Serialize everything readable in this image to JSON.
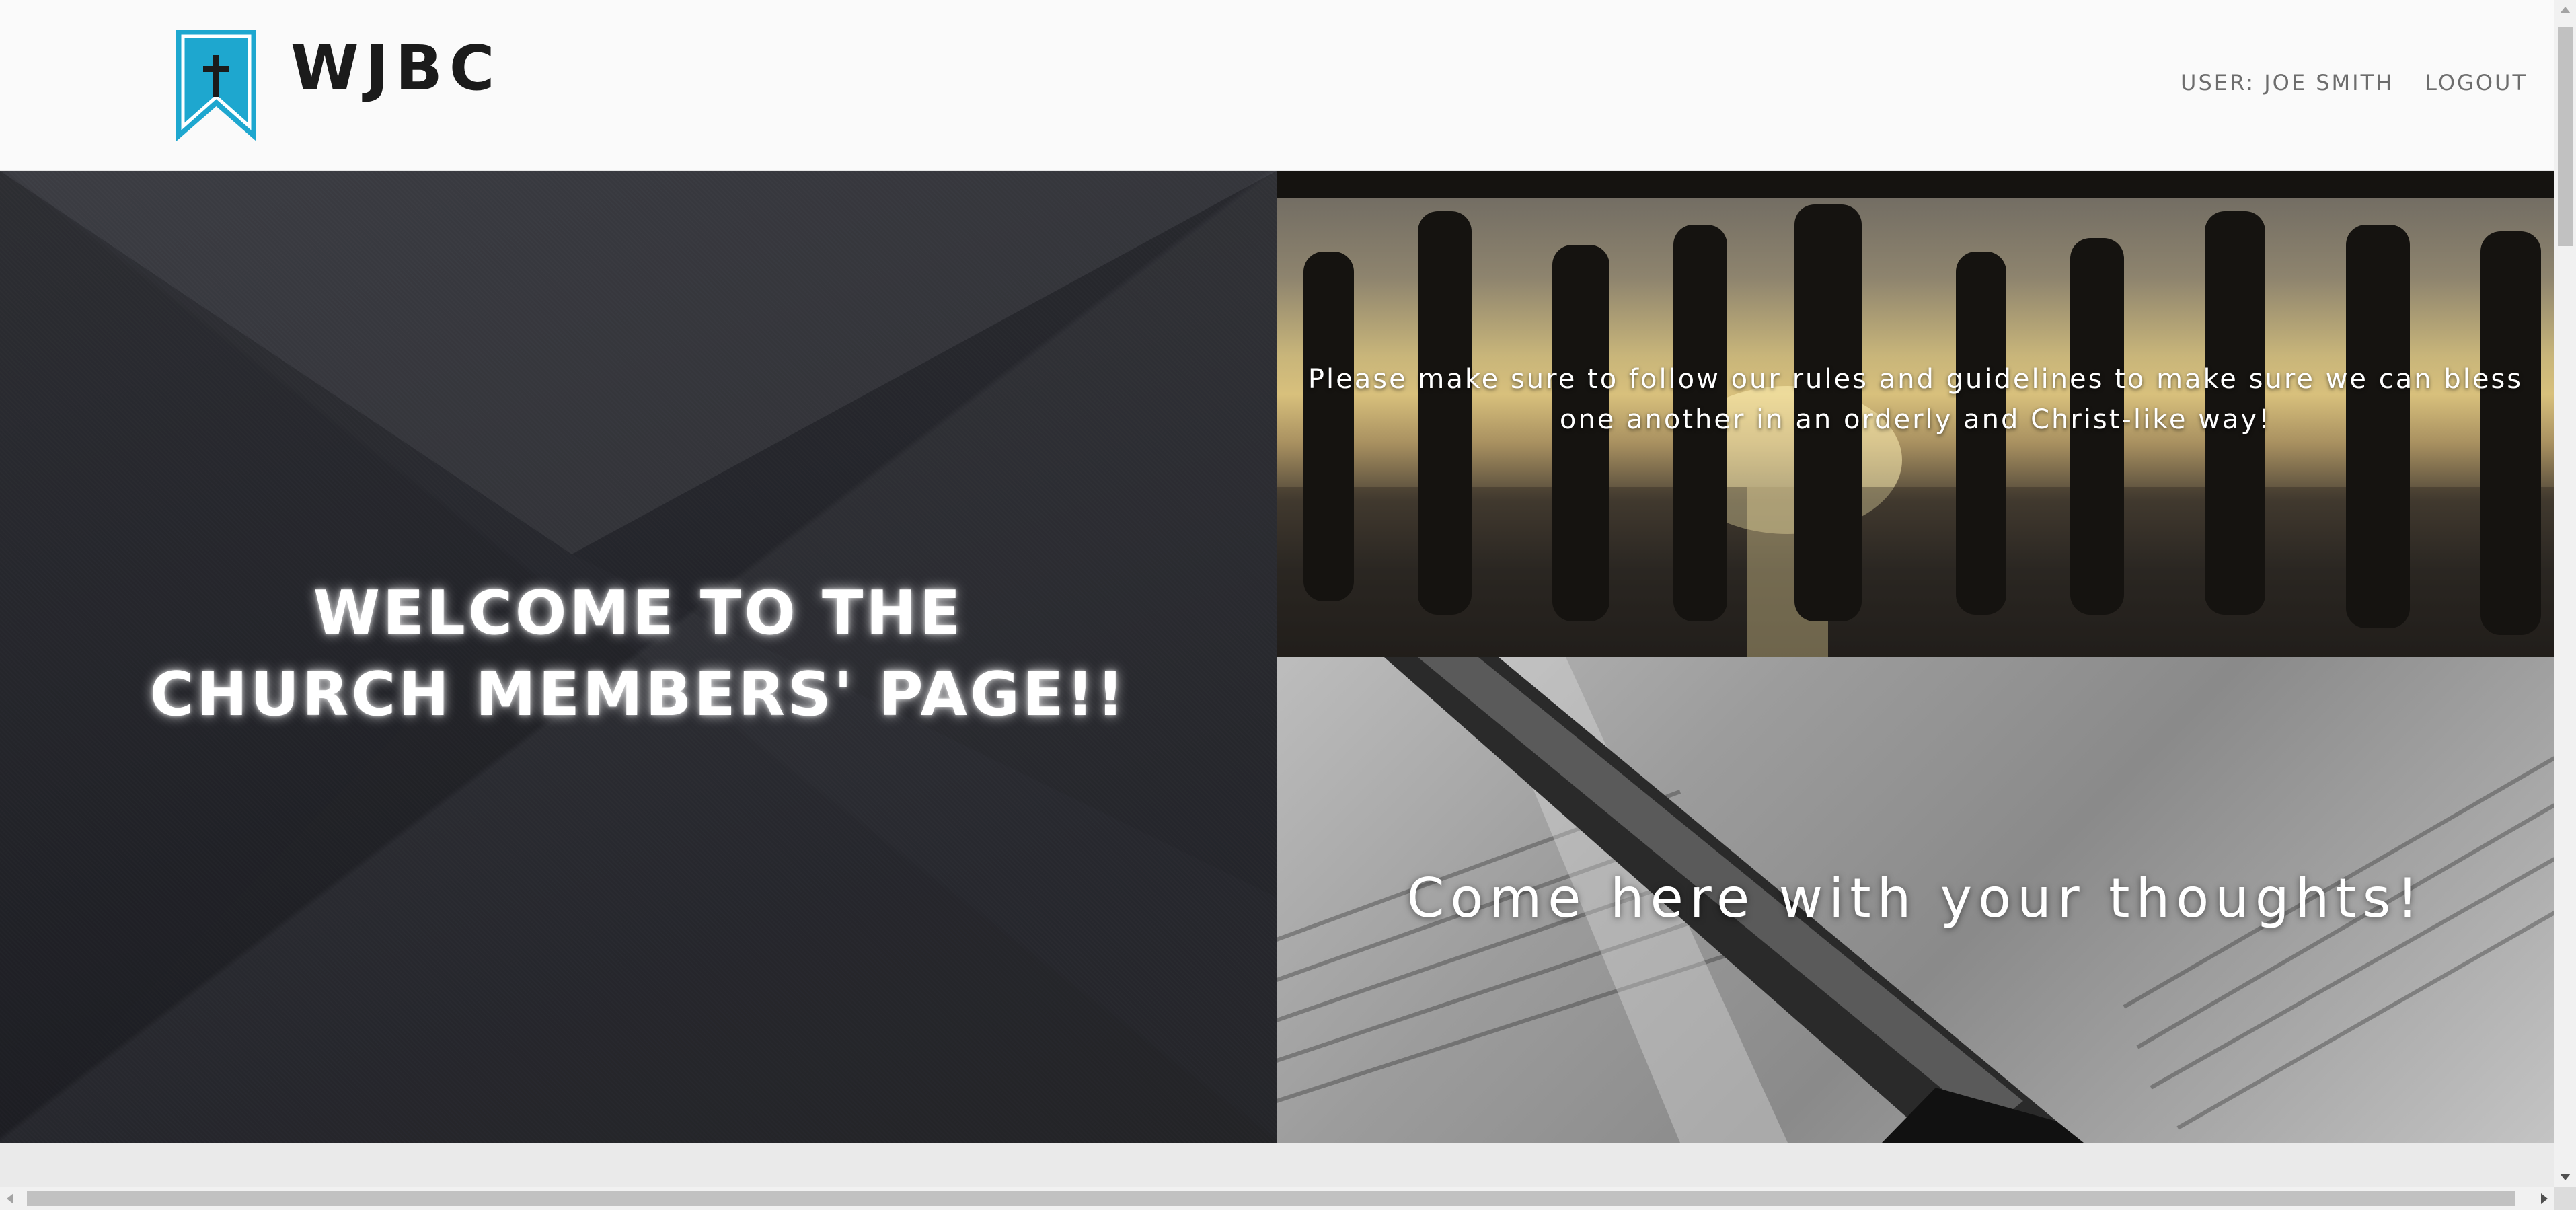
{
  "header": {
    "brand": "WJBC",
    "logo_icon": "cross-bookmark-icon",
    "nav": {
      "user_label": "USER: JOE SMITH",
      "logout_label": "LOGOUT"
    }
  },
  "hero": {
    "welcome_line1": "WELCOME TO THE",
    "welcome_line2": "CHURCH MEMBERS' PAGE!!"
  },
  "panels": {
    "rules": {
      "text": "Please make sure to follow our rules and guidelines to make sure we can bless one another in an orderly and Christ-like way!"
    },
    "thoughts": {
      "text": "Come here with your thoughts!"
    }
  },
  "colors": {
    "accent": "#1ea7cf",
    "header_bg": "#fafafa",
    "hero_dark": "#26272c"
  }
}
